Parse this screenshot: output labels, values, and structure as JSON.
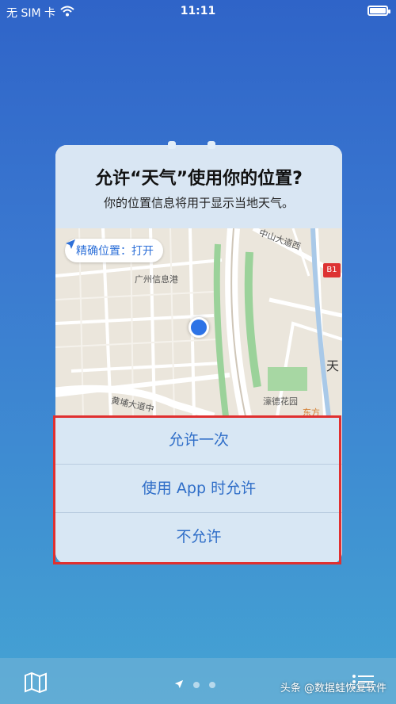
{
  "status_bar": {
    "carrier": "无 SIM 卡",
    "time": "11:11",
    "battery_level": 0.85
  },
  "dialog": {
    "title": "允许“天气”使用你的位置?",
    "subtitle": "你的位置信息将用于显示当地天气。",
    "precise_location": "精确位置：打开",
    "map_labels": {
      "guangzhou": "广州信息港",
      "zhongshan": "中山大道西",
      "tianhe": "天",
      "park": "濠德花园",
      "road": "黄埔大道中",
      "east": "东方",
      "badge": "B1"
    },
    "options": [
      {
        "label": "允许一次"
      },
      {
        "label": "使用 App 时允许"
      },
      {
        "label": "不允许"
      }
    ]
  },
  "bottom_bar": {
    "icons": [
      "map-icon",
      "location-arrow-icon",
      "list-icon"
    ]
  },
  "watermark": "头条 @数据蛙恢复软件",
  "colors": {
    "accent": "#2f6ec8",
    "highlight": "#e03030"
  }
}
